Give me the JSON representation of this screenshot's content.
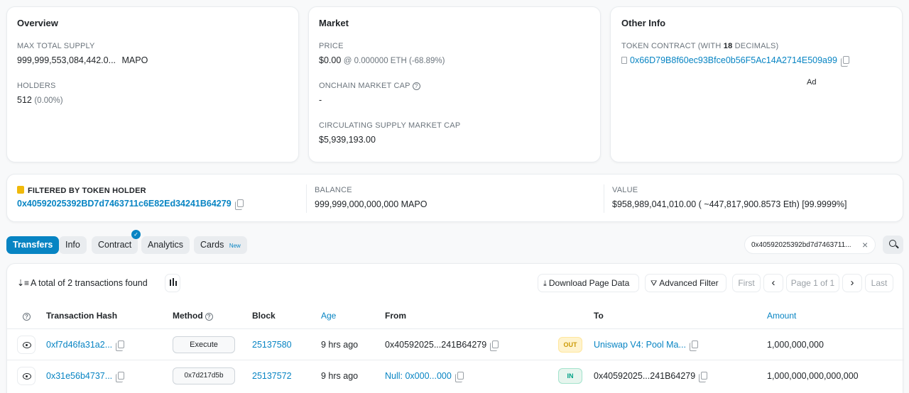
{
  "overview": {
    "title": "Overview",
    "max_supply_label": "MAX TOTAL SUPPLY",
    "max_supply_value": "999,999,553,084,442.0...",
    "max_supply_symbol": "MAPO",
    "holders_label": "HOLDERS",
    "holders_value": "512",
    "holders_pct": "(0.00%)"
  },
  "market": {
    "title": "Market",
    "price_label": "PRICE",
    "price_value": "$0.00",
    "price_eth": "@ 0.000000 ETH (-68.89%)",
    "onchain_cap_label": "ONCHAIN MARKET CAP",
    "onchain_cap_value": "-",
    "circ_cap_label": "CIRCULATING SUPPLY MARKET CAP",
    "circ_cap_value": "$5,939,193.00"
  },
  "other_info": {
    "title": "Other Info",
    "contract_label_prefix": "TOKEN CONTRACT (WITH ",
    "contract_decimals": "18",
    "contract_label_suffix": " DECIMALS)",
    "contract_address": "0x66D79B8f60ec93Bfce0b56F5Ac14A2714E509a99",
    "ad_label": "Ad"
  },
  "filter": {
    "label": "FILTERED BY TOKEN HOLDER",
    "address": "0x40592025392BD7d7463711c6E82Ed34241B64279",
    "balance_label": "BALANCE",
    "balance_value": "999,999,000,000,000 MAPO",
    "value_label": "VALUE",
    "value_value": "$958,989,041,010.00 ( ~447,817,900.8573 Eth) [99.9999%]"
  },
  "tabs": [
    {
      "label": "Transfers"
    },
    {
      "label": "Info"
    },
    {
      "label": "Contract"
    },
    {
      "label": "Analytics"
    },
    {
      "label": "Cards",
      "badge": "New"
    }
  ],
  "search": {
    "value": "0x40592025392bd7d7463711...",
    "clear": "×"
  },
  "toolbar": {
    "summary": "A total of 2 transactions found",
    "download": "Download Page Data",
    "advanced_filter": "Advanced Filter",
    "first": "First",
    "prev": "‹",
    "page": "Page 1 of 1",
    "next": "›",
    "last": "Last"
  },
  "table": {
    "headers": {
      "help": "?",
      "hash": "Transaction Hash",
      "method": "Method",
      "block": "Block",
      "age": "Age",
      "from": "From",
      "to": "To",
      "amount": "Amount"
    },
    "rows": [
      {
        "hash": "0xf7d46fa31a2...",
        "method": "Execute",
        "block": "25137580",
        "age": "9 hrs ago",
        "from": "0x40592025...241B64279",
        "direction": "OUT",
        "to": "Uniswap V4: Pool Ma...",
        "amount": "1,000,000,000"
      },
      {
        "hash": "0x31e56b4737...",
        "method": "0x7d217d5b",
        "block": "25137572",
        "age": "9 hrs ago",
        "from": "Null: 0x000...000",
        "direction": "IN",
        "to": "0x40592025...241B64279",
        "amount": "1,000,000,000,000,000"
      }
    ]
  },
  "colors": {
    "accent": "#0784c3",
    "out": "#cc9a06",
    "in": "#00a186"
  }
}
